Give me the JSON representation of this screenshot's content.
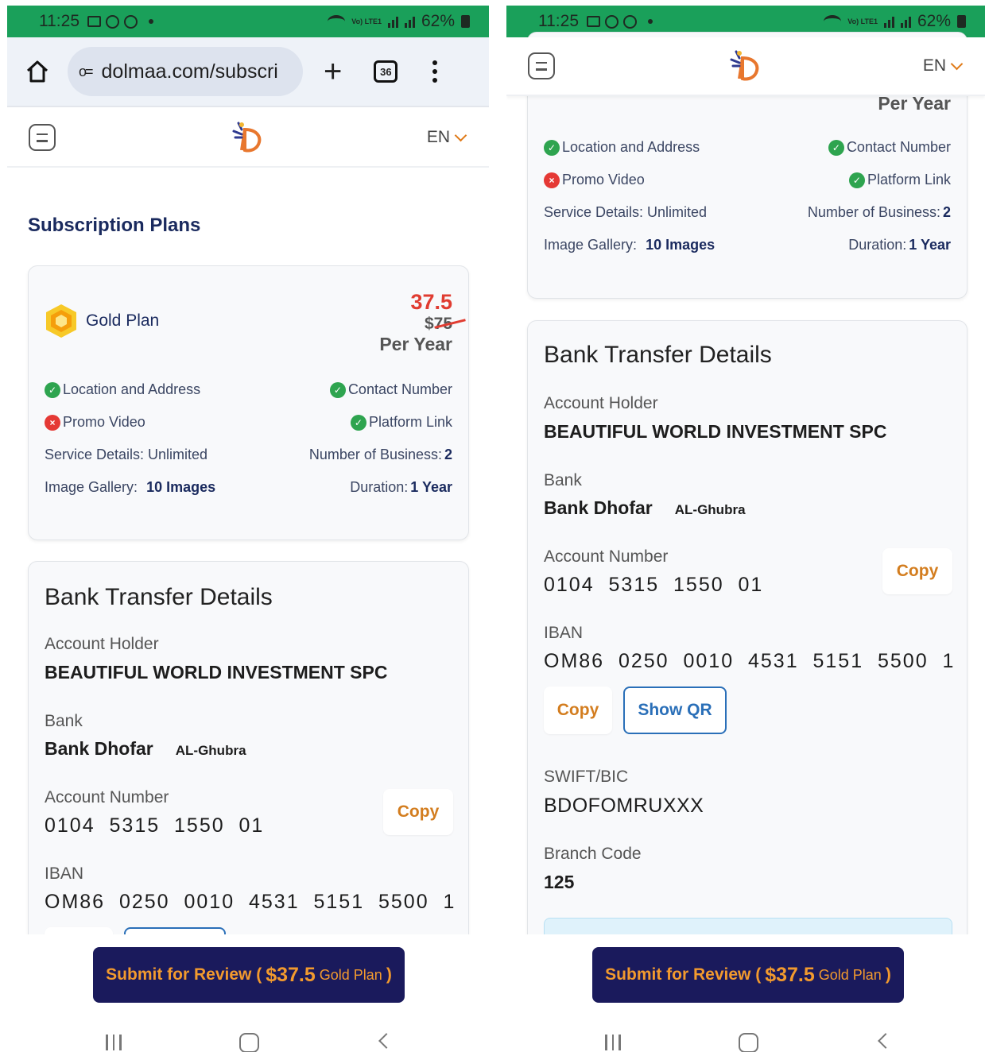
{
  "status_bar": {
    "time": "11:25",
    "battery": "62%",
    "network": "Vo) LTE1"
  },
  "browser": {
    "url": "dolmaa.com/subscri",
    "tab_count": "36",
    "icons": [
      "home-icon",
      "site-settings-icon",
      "new-tab-icon",
      "tab-switcher-icon",
      "more-options-icon"
    ]
  },
  "app_header": {
    "language": "EN",
    "icons": [
      "menu-icon",
      "dolmaa-logo",
      "chevron-down-icon"
    ]
  },
  "page": {
    "title": "Subscription Plans"
  },
  "plan": {
    "name": "Gold Plan",
    "price_new": "37.5",
    "price_currency": "$",
    "price_old": "75",
    "period": "Per Year",
    "features": {
      "location": "Location and Address",
      "contact": "Contact Number",
      "promo": "Promo Video",
      "platform": "Platform Link",
      "service_label": "Service Details: Unlimited",
      "business_label": "Number of Business:",
      "business_value": "2",
      "gallery_label": "Image Gallery:",
      "gallery_value": "10 Images",
      "duration_label": "Duration:",
      "duration_value": "1 Year"
    },
    "colors": {
      "included": "#2ea44f",
      "excluded": "#e53935"
    }
  },
  "bank_transfer": {
    "title": "Bank Transfer Details",
    "holder_label": "Account Holder",
    "holder_value": "BEAUTIFUL WORLD INVESTMENT SPC",
    "bank_label": "Bank",
    "bank_value": "Bank Dhofar",
    "branch_name": "AL-Ghubra",
    "account_label": "Account Number",
    "account_value": "0104  5315  1550  01",
    "iban_label": "IBAN",
    "iban_value": "OM86  0250  0010  4531  5151  5500  1",
    "swift_label": "SWIFT/BIC",
    "swift_value": "BDOFOMRUXXX",
    "branch_code_label": "Branch Code",
    "branch_code_value": "125",
    "copy_label": "Copy",
    "show_qr_label": "Show QR"
  },
  "submit": {
    "prefix": "Submit for Review (",
    "amount": "$37.5",
    "plan": "Gold Plan",
    "suffix": ")",
    "colors": {
      "background": "#1a1a5c",
      "text": "#f29a2e"
    }
  }
}
